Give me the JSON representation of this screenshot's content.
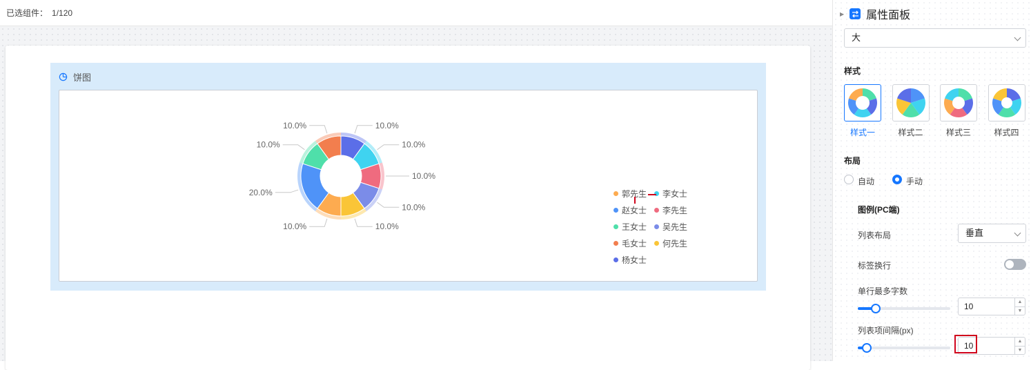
{
  "topbar": {
    "selected_label": "已选组件：",
    "selected_count": "1/120"
  },
  "widget": {
    "title": "饼图"
  },
  "chart_data": {
    "type": "pie",
    "donut": true,
    "categories": [
      "郭先生",
      "李女士",
      "赵女士",
      "李先生",
      "王女士",
      "吴先生",
      "毛女士",
      "何先生",
      "杨女士"
    ],
    "values": [
      10,
      10,
      20,
      10,
      10,
      10,
      10,
      10,
      10
    ],
    "slices": [
      {
        "name": "杨女士",
        "value": 10,
        "label": "10.0%",
        "color": "#5b6ee8"
      },
      {
        "name": "李女士",
        "value": 10,
        "label": "10.0%",
        "color": "#3fd3f0"
      },
      {
        "name": "李先生",
        "value": 10,
        "label": "10.0%",
        "color": "#ef6b7f"
      },
      {
        "name": "吴先生",
        "value": 10,
        "label": "10.0%",
        "color": "#7b8ce8"
      },
      {
        "name": "何先生",
        "value": 10,
        "label": "10.0%",
        "color": "#fac537"
      },
      {
        "name": "郭先生",
        "value": 10,
        "label": "10.0%",
        "color": "#fdab50"
      },
      {
        "name": "赵女士",
        "value": 20,
        "label": "20.0%",
        "color": "#4f93f8"
      },
      {
        "name": "王女士",
        "value": 10,
        "label": "10.0%",
        "color": "#4fdfaa"
      },
      {
        "name": "毛女士",
        "value": 10,
        "label": "10.0%",
        "color": "#f27e4e"
      }
    ],
    "legend": [
      {
        "name": "郭先生",
        "color": "#fdab50"
      },
      {
        "name": "李女士",
        "color": "#3fd3f0"
      },
      {
        "name": "赵女士",
        "color": "#4f93f8"
      },
      {
        "name": "李先生",
        "color": "#ef6b7f"
      },
      {
        "name": "王女士",
        "color": "#4fdfaa"
      },
      {
        "name": "吴先生",
        "color": "#7b8ce8"
      },
      {
        "name": "毛女士",
        "color": "#f27e4e"
      },
      {
        "name": "何先生",
        "color": "#fac537"
      },
      {
        "name": "杨女士",
        "color": "#5b6ee8"
      }
    ],
    "legend_placement": "right"
  },
  "panel": {
    "title": "属性面板",
    "size_select": "大",
    "style_section": "样式",
    "styles": [
      "样式一",
      "样式二",
      "样式三",
      "样式四"
    ],
    "active_style": 0,
    "layout_section": "布局",
    "layout_auto": "自动",
    "layout_manual": "手动",
    "layout_selected": "手动",
    "legend_section": "图例(PC端)",
    "list_layout_label": "列表布局",
    "list_layout_value": "垂直",
    "wrap_label": "标签换行",
    "wrap_on": false,
    "max_chars_label": "单行最多字数",
    "max_chars_value": "10",
    "gap_label": "列表项间隔(px)",
    "gap_value": "10"
  },
  "colors": {
    "accent": "#1677ff",
    "highlight": "#d0021b"
  }
}
